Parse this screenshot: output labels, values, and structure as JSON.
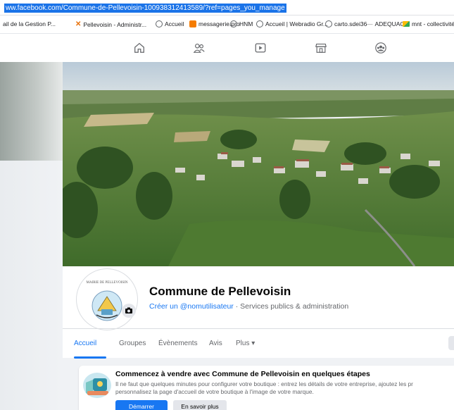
{
  "browser": {
    "url": "ww.facebook.com/Commune-de-Pellevoisin-100938312413589/?ref=pages_you_manage",
    "bookmarks": [
      {
        "label": "ail de la Gestion P...",
        "icon": "none"
      },
      {
        "label": "Pellevoisin - Administr...",
        "icon": "cross-logo-icon"
      },
      {
        "label": "Accueil",
        "icon": "globe-icon"
      },
      {
        "label": "messagerie.pro",
        "icon": "mail-square-icon"
      },
      {
        "label": "HNM",
        "icon": "globe-icon"
      },
      {
        "label": "Accueil | Webradio Gr...",
        "icon": "globe-icon"
      },
      {
        "label": "carto.sdei36",
        "icon": "globe-icon"
      },
      {
        "label": "ADEQUACY",
        "icon": "dash-icon"
      },
      {
        "label": "mnt - collectivités",
        "icon": "folder-logo-icon"
      }
    ]
  },
  "fb_nav": {
    "icons": [
      "home-icon",
      "friends-icon",
      "watch-icon",
      "marketplace-icon",
      "groups-icon"
    ]
  },
  "profile": {
    "name": "Commune de Pellevoisin",
    "username_link": "Créer un @nomutilisateur",
    "category": " · Services publics & administration",
    "avatar_text": {
      "line1": "MAIRIE DE PELLEVOISIN"
    }
  },
  "tabs": [
    {
      "label": "Accueil",
      "active": true
    },
    {
      "label": "Groupes",
      "active": false
    },
    {
      "label": "Évènements",
      "active": false
    },
    {
      "label": "Avis",
      "active": false
    },
    {
      "label": "Plus ▾",
      "active": false
    }
  ],
  "shop_card": {
    "title": "Commencez à vendre avec Commune de Pellevoisin en quelques étapes",
    "desc_line1": "Il ne faut que quelques minutes pour configurer votre boutique : entrez les détails de votre entreprise, ajoutez les pr",
    "desc_line2": "personnalisez la page d'accueil de votre boutique à l'image de votre marque.",
    "primary_label": "Démarrer",
    "secondary_label": "En savoir plus"
  },
  "colors": {
    "accent": "#1877f2",
    "url_highlight": "#1a73e8",
    "text_secondary": "#65676b"
  }
}
